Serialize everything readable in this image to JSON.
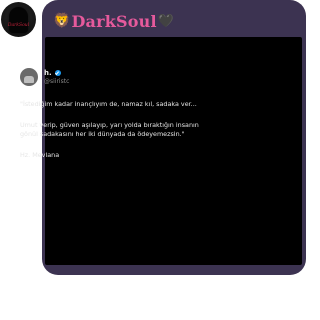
{
  "sender": {
    "avatar_signature": "DarkSoul"
  },
  "message": {
    "group_name": "DarkSoul",
    "lion_emoji": "🦁",
    "heart_emoji": "🖤",
    "bubble_color": "#3c3351",
    "name_color": "#e65a9c"
  },
  "tweet": {
    "display_name": "h.",
    "handle": "@siiristc",
    "verified": true,
    "line1": "\"İstediğim kadar inançlıyım de, namaz kıl, sadaka ver...",
    "line2": "Umut verip, güven aşılayıp, yarı yolda bıraktığın insanın",
    "line3": "gönül sadakasını her iki dünyada da ödeyemezsin.\"",
    "line4": "Hz. Mevlana"
  }
}
